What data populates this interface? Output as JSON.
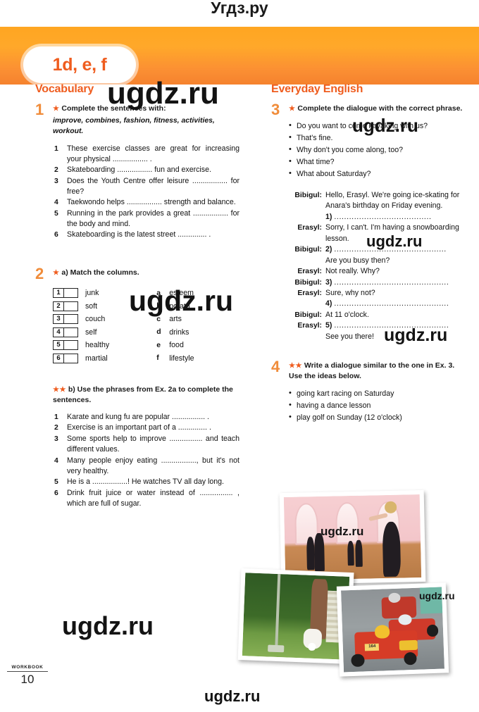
{
  "watermarks": {
    "top": "Угдз.ру",
    "site": "ugdz.ru"
  },
  "header": {
    "tab_label": "1d, e, f",
    "banner_color": "#fb9328",
    "accent_color": "#ef5c1e"
  },
  "left_column": {
    "section_title": "Vocabulary",
    "ex1": {
      "number": "1",
      "stars": "★",
      "rubric": "Complete the sentences with:",
      "wordbank": "improve, combines, fashion, fitness, activities, workout.",
      "items": [
        {
          "n": "1",
          "text": "These exercise classes are great for increasing your physical ................. ."
        },
        {
          "n": "2",
          "text": "Skateboarding ................. fun and exercise."
        },
        {
          "n": "3",
          "text": "Does the Youth Centre offer leisure ................. for free?"
        },
        {
          "n": "4",
          "text": "Taekwondo helps ................. strength and balance."
        },
        {
          "n": "5",
          "text": "Running in the park provides a great ................. for the body and mind."
        },
        {
          "n": "6",
          "text": "Skateboarding is the latest street .............. ."
        }
      ]
    },
    "ex2": {
      "number": "2",
      "stars_a": "★",
      "rubric_a": "a)  Match the columns.",
      "match_left": [
        {
          "n": "1",
          "word": "junk"
        },
        {
          "n": "2",
          "word": "soft"
        },
        {
          "n": "3",
          "word": "couch"
        },
        {
          "n": "4",
          "word": "self"
        },
        {
          "n": "5",
          "word": "healthy"
        },
        {
          "n": "6",
          "word": "martial"
        }
      ],
      "match_right": [
        {
          "l": "a",
          "word": "esteem"
        },
        {
          "l": "b",
          "word": "potato"
        },
        {
          "l": "c",
          "word": "arts"
        },
        {
          "l": "d",
          "word": "drinks"
        },
        {
          "l": "e",
          "word": "food"
        },
        {
          "l": "f",
          "word": "lifestyle"
        }
      ],
      "stars_b": "★★",
      "rubric_b": "b) Use the phrases from Ex. 2a to complete the sentences.",
      "items_b": [
        {
          "n": "1",
          "text": "Karate and kung fu are popular ................ ."
        },
        {
          "n": "2",
          "text": "Exercise is an important part of a .............. ."
        },
        {
          "n": "3",
          "text": "Some sports help to improve ................ and teach different values."
        },
        {
          "n": "4",
          "text": "Many people enjoy eating ................., but it's not very healthy."
        },
        {
          "n": "5",
          "text": "He is a .................! He watches TV all day long."
        },
        {
          "n": "6",
          "text": "Drink fruit juice or water instead of ................ , which are full of sugar."
        }
      ]
    }
  },
  "right_column": {
    "section_title": "Everyday English",
    "ex3": {
      "number": "3",
      "stars": "★",
      "rubric": "Complete the dialogue with the correct phrase.",
      "phrases": [
        "Do you want to come kayaking with us?",
        "That's fine.",
        "Why don't you come along, too?",
        "What time?",
        "What about Saturday?"
      ],
      "dialogue": [
        {
          "speaker": "Bibigul:",
          "lines": [
            "Hello, Erasyl. We're going ice-skating for",
            "Anara's birthday on Friday evening."
          ],
          "gap": "1)",
          "dots": "......................................."
        },
        {
          "speaker": "Erasyl:",
          "lines": [
            "Sorry, I can't. I'm having a snowboarding",
            "lesson."
          ]
        },
        {
          "speaker": "Bibigul:",
          "gap": "2)",
          "dots": ".............................................",
          "after": [
            "Are you busy then?"
          ]
        },
        {
          "speaker": "Erasyl:",
          "lines": [
            "Not really. Why?"
          ]
        },
        {
          "speaker": "Bibigul:",
          "gap": "3)",
          "dots": ".............................................."
        },
        {
          "speaker": "Erasyl:",
          "lines": [
            "Sure, why not?"
          ],
          "gap_after": "4)",
          "dots_after": ".............................................."
        },
        {
          "speaker": "Bibigul:",
          "lines": [
            "At 11 o'clock."
          ]
        },
        {
          "speaker": "Erasyl:",
          "gap": "5)",
          "dots": "..............................................",
          "after": [
            "See you there!"
          ]
        }
      ]
    },
    "ex4": {
      "number": "4",
      "stars": "★★",
      "rubric": "Write a dialogue similar to the one in Ex. 3. Use the ideas below.",
      "ideas": [
        "going kart racing on Saturday",
        "having a dance lesson",
        "play golf on Sunday (12 o'clock)"
      ]
    },
    "photos": [
      {
        "name": "ballroom-dancing-photo"
      },
      {
        "name": "golf-photo"
      },
      {
        "name": "kart-racing-photo"
      }
    ]
  },
  "footer": {
    "label": "WORKBOOK",
    "page_number": "10"
  },
  "kart_number": "164"
}
